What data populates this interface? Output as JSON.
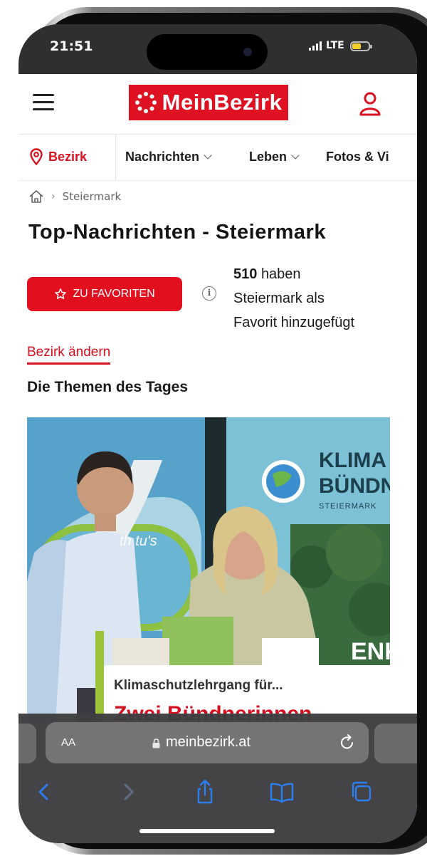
{
  "status_bar": {
    "time": "21:51",
    "network": "LTE"
  },
  "header": {
    "logo_text": "MeinBezirk",
    "brand_color": "#df1224"
  },
  "nav": {
    "bezirk_label": "Bezirk",
    "items": [
      {
        "label": "Nachrichten"
      },
      {
        "label": "Leben"
      },
      {
        "label": "Fotos & Vi"
      }
    ]
  },
  "breadcrumb": {
    "current": "Steiermark"
  },
  "page": {
    "title": "Top-Nachrichten - Steiermark",
    "favorite_button": "ZU FAVORITEN",
    "favorite_count": "510",
    "favorite_text_1": "haben",
    "favorite_text_2": "Steiermark als",
    "favorite_text_3": "Favorit hinzugefügt",
    "change_district": "Bezirk ändern",
    "topics_heading": "Die Themen des Tages"
  },
  "article": {
    "caption_title": "Klimaschutzlehrgang für...",
    "caption_subtitle": "Zwei Bündnerinnen",
    "photo_text_1": "KLIMA",
    "photo_text_2": "BÜNDN",
    "photo_text_3": "STEIERMARK",
    "photo_text_4": "th tu's",
    "photo_text_5": "ENK"
  },
  "safari": {
    "aa_label": "AA",
    "url": "meinbezirk.at"
  },
  "icons": [
    "menu-icon",
    "user-icon",
    "location-pin-icon",
    "home-icon",
    "star-icon",
    "info-icon",
    "lock-icon",
    "reload-icon",
    "back-icon",
    "forward-icon",
    "share-icon",
    "bookmarks-icon",
    "tabs-icon"
  ]
}
